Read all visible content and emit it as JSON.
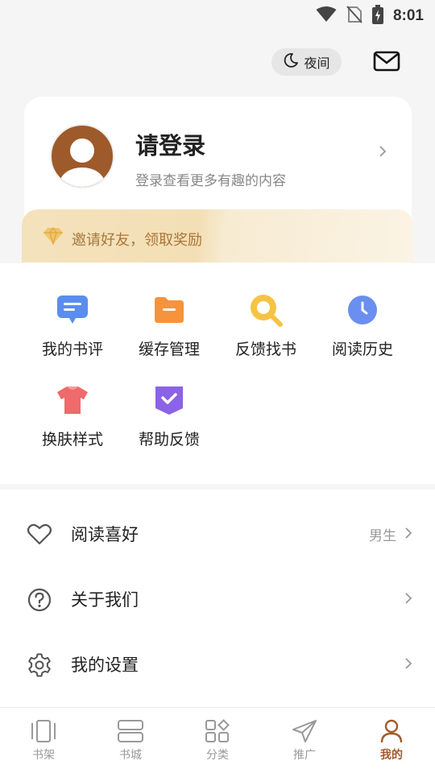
{
  "status_bar": {
    "time": "8:01"
  },
  "top": {
    "night_label": "夜间"
  },
  "profile": {
    "title": "请登录",
    "subtitle": "登录查看更多有趣的内容"
  },
  "invite": {
    "text": "邀请好友，领取奖励"
  },
  "grid": [
    {
      "label": "我的书评",
      "icon": "comment-icon",
      "color": "#5b8def"
    },
    {
      "label": "缓存管理",
      "icon": "folder-icon",
      "color": "#f7933a"
    },
    {
      "label": "反馈找书",
      "icon": "search-icon",
      "color": "#f5c443"
    },
    {
      "label": "阅读历史",
      "icon": "clock-icon",
      "color": "#6a8ff0"
    },
    {
      "label": "换肤样式",
      "icon": "shirt-icon",
      "color": "#ef6a6a"
    },
    {
      "label": "帮助反馈",
      "icon": "help-icon",
      "color": "#8b63e6"
    }
  ],
  "list": [
    {
      "label": "阅读喜好",
      "value": "男生",
      "icon": "heart-icon"
    },
    {
      "label": "关于我们",
      "value": "",
      "icon": "question-icon"
    },
    {
      "label": "我的设置",
      "value": "",
      "icon": "gear-icon"
    }
  ],
  "tabs": [
    {
      "label": "书架",
      "icon": "bookshelf-icon"
    },
    {
      "label": "书城",
      "icon": "bookstore-icon"
    },
    {
      "label": "分类",
      "icon": "category-icon"
    },
    {
      "label": "推广",
      "icon": "send-icon"
    },
    {
      "label": "我的",
      "icon": "profile-icon",
      "active": true
    }
  ],
  "colors": {
    "accent": "#a05a2c",
    "invite_text": "#a8763a"
  }
}
